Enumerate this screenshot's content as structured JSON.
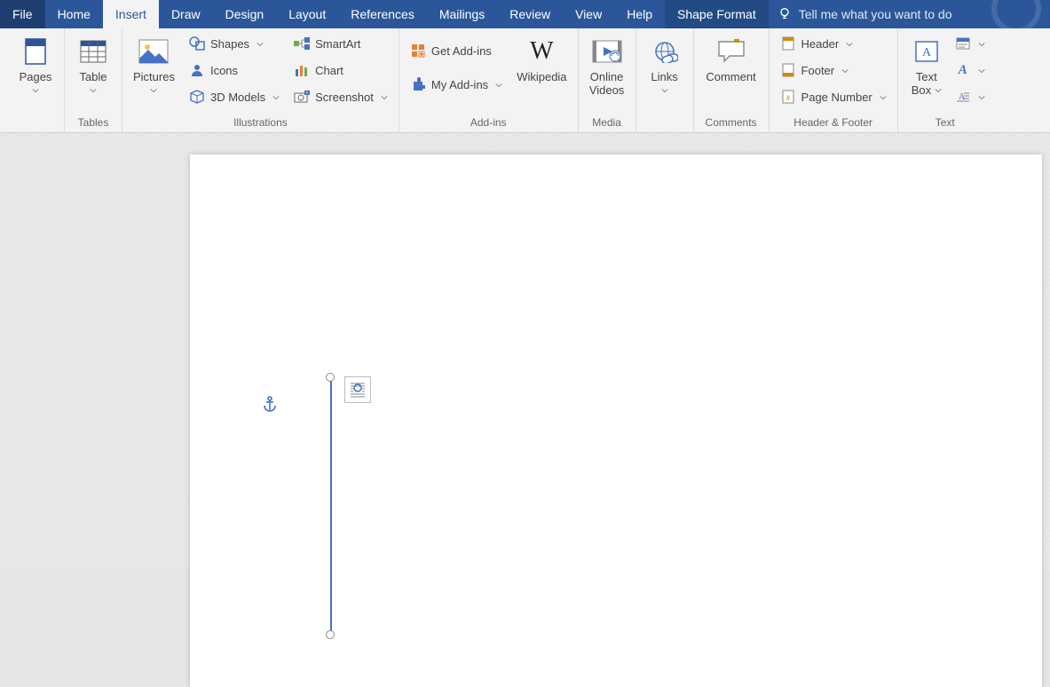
{
  "tabs": {
    "file": "File",
    "home": "Home",
    "insert": "Insert",
    "draw": "Draw",
    "design": "Design",
    "layout": "Layout",
    "references": "References",
    "mailings": "Mailings",
    "review": "Review",
    "view": "View",
    "help": "Help",
    "shape_format": "Shape Format",
    "tell_me": "Tell me what you want to do"
  },
  "groups": {
    "pages": {
      "label": "",
      "pages_btn": "Pages"
    },
    "tables": {
      "label": "Tables",
      "table_btn": "Table"
    },
    "illustrations": {
      "label": "Illustrations",
      "pictures_btn": "Pictures",
      "shapes": "Shapes",
      "icons": "Icons",
      "models3d": "3D Models",
      "smartart": "SmartArt",
      "chart": "Chart",
      "screenshot": "Screenshot"
    },
    "addins": {
      "label": "Add-ins",
      "get": "Get Add-ins",
      "my": "My Add-ins",
      "wikipedia": "Wikipedia"
    },
    "media": {
      "label": "Media",
      "online_videos": "Online\nVideos"
    },
    "links": {
      "label": "",
      "links_btn": "Links"
    },
    "comments": {
      "label": "Comments",
      "comment_btn": "Comment"
    },
    "headerfooter": {
      "label": "Header & Footer",
      "header": "Header",
      "footer": "Footer",
      "page_number": "Page Number"
    },
    "text": {
      "label": "Text",
      "text_box": "Text\nBox"
    }
  }
}
